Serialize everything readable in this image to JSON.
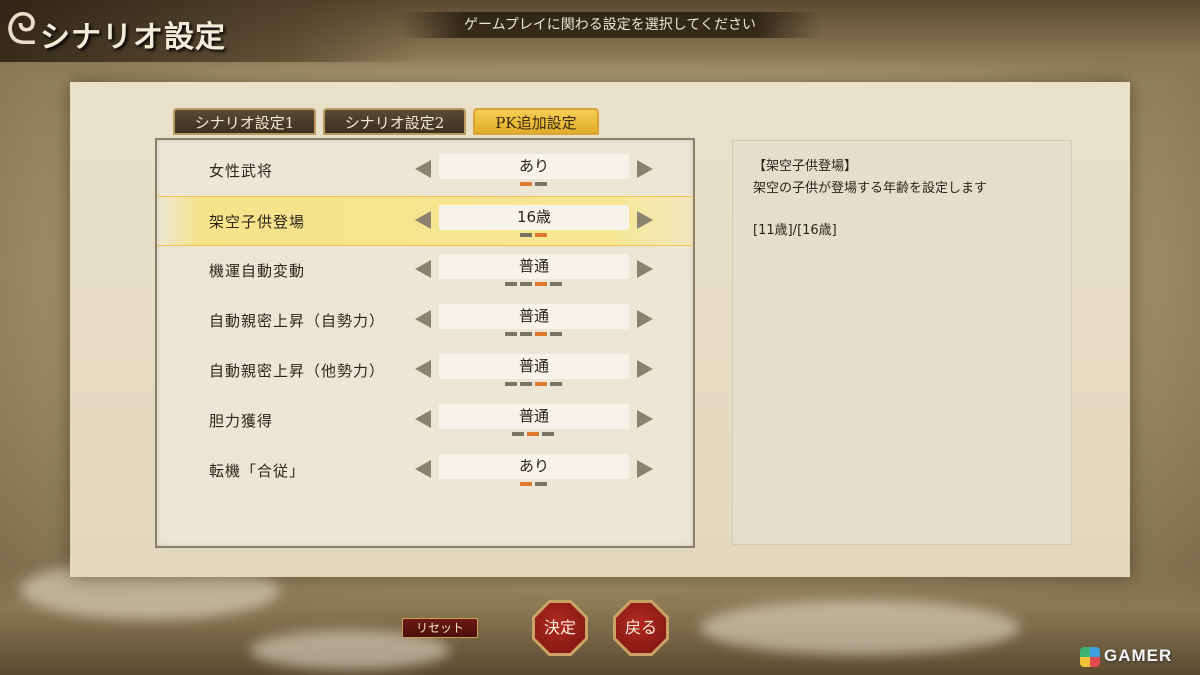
{
  "header": {
    "title": "シナリオ設定",
    "hint": "ゲームプレイに関わる設定を選択してください"
  },
  "tabs": [
    {
      "label": "シナリオ設定1",
      "active": false
    },
    {
      "label": "シナリオ設定2",
      "active": false
    },
    {
      "label": "PK追加設定",
      "active": true
    }
  ],
  "settings": [
    {
      "label": "女性武将",
      "value": "あり",
      "options_count": 2,
      "selected_index": 0
    },
    {
      "label": "架空子供登場",
      "value": "16歳",
      "options_count": 2,
      "selected_index": 1,
      "selected": true
    },
    {
      "label": "機運自動変動",
      "value": "普通",
      "options_count": 4,
      "selected_index": 2
    },
    {
      "label": "自動親密上昇（自勢力）",
      "value": "普通",
      "options_count": 4,
      "selected_index": 2
    },
    {
      "label": "自動親密上昇（他勢力）",
      "value": "普通",
      "options_count": 4,
      "selected_index": 2
    },
    {
      "label": "胆力獲得",
      "value": "普通",
      "options_count": 3,
      "selected_index": 1
    },
    {
      "label": "転機「合従」",
      "value": "あり",
      "options_count": 2,
      "selected_index": 0
    }
  ],
  "description": {
    "title": "【架空子供登場】",
    "text": "架空の子供が登場する年齢を設定します",
    "range": "[11歳]/[16歳]"
  },
  "buttons": {
    "reset": "リセット",
    "confirm": "決定",
    "back": "戻る"
  },
  "watermark": "GAMER",
  "colors": {
    "accent_orange": "#e0782e",
    "tab_active": "#f0c040",
    "button_red": "#9a1f18",
    "selected_row": "#f6e38a"
  }
}
